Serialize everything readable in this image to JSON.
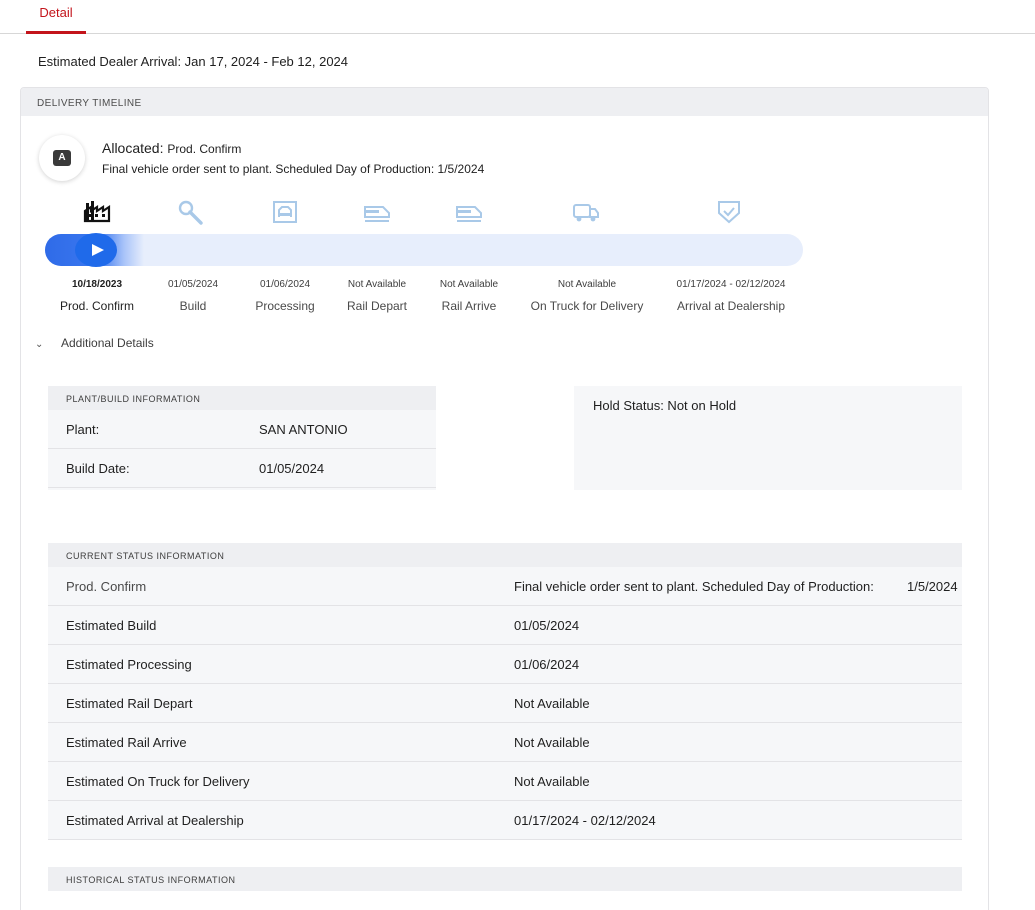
{
  "tabs": {
    "detail_label": "Detail"
  },
  "estimated_arrival": "Estimated Dealer Arrival: Jan 17, 2024 - Feb 12, 2024",
  "timeline": {
    "header": "DELIVERY TIMELINE",
    "avatar_letter": "A",
    "status_label": "Allocated:",
    "status_value": "Prod. Confirm",
    "status_description": "Final vehicle order sent to plant. Scheduled Day of Production: 1/5/2024",
    "progress_percent": 9,
    "stages": [
      {
        "icon": "factory-icon",
        "date": "10/18/2023",
        "name": "Prod. Confirm",
        "active": true
      },
      {
        "icon": "wrench-icon",
        "date": "01/05/2024",
        "name": "Build",
        "active": false
      },
      {
        "icon": "processing-icon",
        "date": "01/06/2024",
        "name": "Processing",
        "active": false
      },
      {
        "icon": "rail-depart-icon",
        "date": "Not Available",
        "name": "Rail Depart",
        "active": false
      },
      {
        "icon": "rail-arrive-icon",
        "date": "Not Available",
        "name": "Rail Arrive",
        "active": false
      },
      {
        "icon": "truck-icon",
        "date": "Not Available",
        "name": "On Truck for Delivery",
        "active": false
      },
      {
        "icon": "shield-check-icon",
        "date": "01/17/2024 - 02/12/2024",
        "name": "Arrival at Dealership",
        "active": false
      }
    ],
    "colors": {
      "accent": "#c3141b",
      "progress": "#1f6aea",
      "icon_inactive": "#a9c9e8"
    }
  },
  "additional_details": {
    "toggle_label": "Additional Details",
    "plant_build": {
      "header": "PLANT/BUILD INFORMATION",
      "plant_label": "Plant:",
      "plant_value": "SAN ANTONIO",
      "build_date_label": "Build Date:",
      "build_date_value": "01/05/2024"
    },
    "hold_status": "Hold Status: Not on Hold",
    "current_status": {
      "header": "CURRENT STATUS INFORMATION",
      "rows": [
        {
          "label": "Prod. Confirm",
          "value": "Final vehicle order sent to plant.  Scheduled Day of Production:",
          "value2": "1/5/2024"
        },
        {
          "label": "Estimated Build",
          "value": "01/05/2024"
        },
        {
          "label": "Estimated Processing",
          "value": "01/06/2024"
        },
        {
          "label": "Estimated Rail Depart",
          "value": "Not Available"
        },
        {
          "label": "Estimated Rail Arrive",
          "value": "Not Available"
        },
        {
          "label": "Estimated On Truck for Delivery",
          "value": "Not Available"
        },
        {
          "label": "Estimated Arrival at Dealership",
          "value": "01/17/2024 - 02/12/2024"
        }
      ]
    },
    "historical_status": {
      "header": "HISTORICAL STATUS INFORMATION"
    }
  }
}
